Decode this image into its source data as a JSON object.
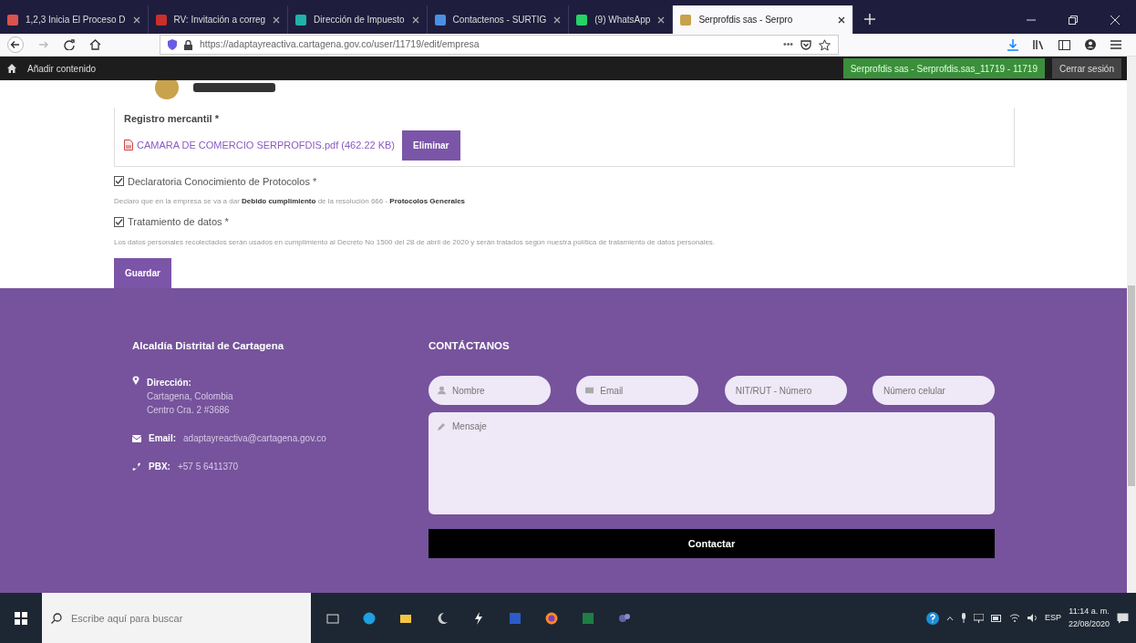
{
  "browser": {
    "tabs": [
      {
        "title": "1,2,3 Inicia El Proceso D",
        "selected": false
      },
      {
        "title": "RV: Invitación a correg",
        "selected": false
      },
      {
        "title": "Dirección de Impuesto",
        "selected": false
      },
      {
        "title": "Contactenos - SURTIG",
        "selected": false
      },
      {
        "title": "(9) WhatsApp",
        "selected": false
      },
      {
        "title": "Serprofdis sas - Serpro",
        "selected": true
      }
    ],
    "url": "https://adaptayreactiva.cartagena.gov.co/user/11719/edit/empresa",
    "page_actions": "•••"
  },
  "admin_bar": {
    "add_content": "Añadir contenido",
    "user": "Serprofdis sas - Serprofdis.sas_11719 - 11719",
    "logout": "Cerrar sesión"
  },
  "form": {
    "field_label": "Registro mercantil *",
    "file": "CAMARA DE COMERCIO SERPROFDIS.pdf (462.22 KB)",
    "delete_button": "Eliminar",
    "checkboxes": [
      {
        "label": "Declaratoria Conocimiento de Protocolos *",
        "checked": true,
        "help": "Declaro que en la empresa se va a dar **Debido cumplimiento** de la resolución 666 - **Protocolos Generales**"
      },
      {
        "label": "Tratamiento de datos *",
        "checked": true,
        "help": "Los datos personales recolectados serán usados en cumplimiento al Decreto No 1500 del 28 de abril de 2020 y serán tratados según nuestra política de tratamiento de datos personales."
      }
    ],
    "save_button": "Guardar"
  },
  "footer": {
    "org_title": "Alcaldía Distrital de Cartagena",
    "address_label": "Dirección:",
    "address_lines": [
      "Cartagena, Colombia",
      "Centro Cra. 2 #3686"
    ],
    "email_label": "Email:",
    "email": "adaptayreactiva@cartagena.gov.co",
    "pbx_label": "PBX:",
    "pbx": "+57 5 6411370",
    "contact_title": "CONTÁCTANOS",
    "inputs": [
      {
        "kind": "person",
        "placeholder": "Nombre"
      },
      {
        "kind": "mail",
        "placeholder": "Email"
      },
      {
        "kind": "plain",
        "placeholder": "NIT/RUT - Número"
      },
      {
        "kind": "plain",
        "placeholder": "Número celular"
      }
    ],
    "message_placeholder": "Mensaje",
    "submit": "Contactar"
  },
  "taskbar": {
    "search_placeholder": "Escribe aquí para buscar",
    "language": "ESP",
    "time": "11:14 a. m.",
    "date": "22/08/2020"
  }
}
